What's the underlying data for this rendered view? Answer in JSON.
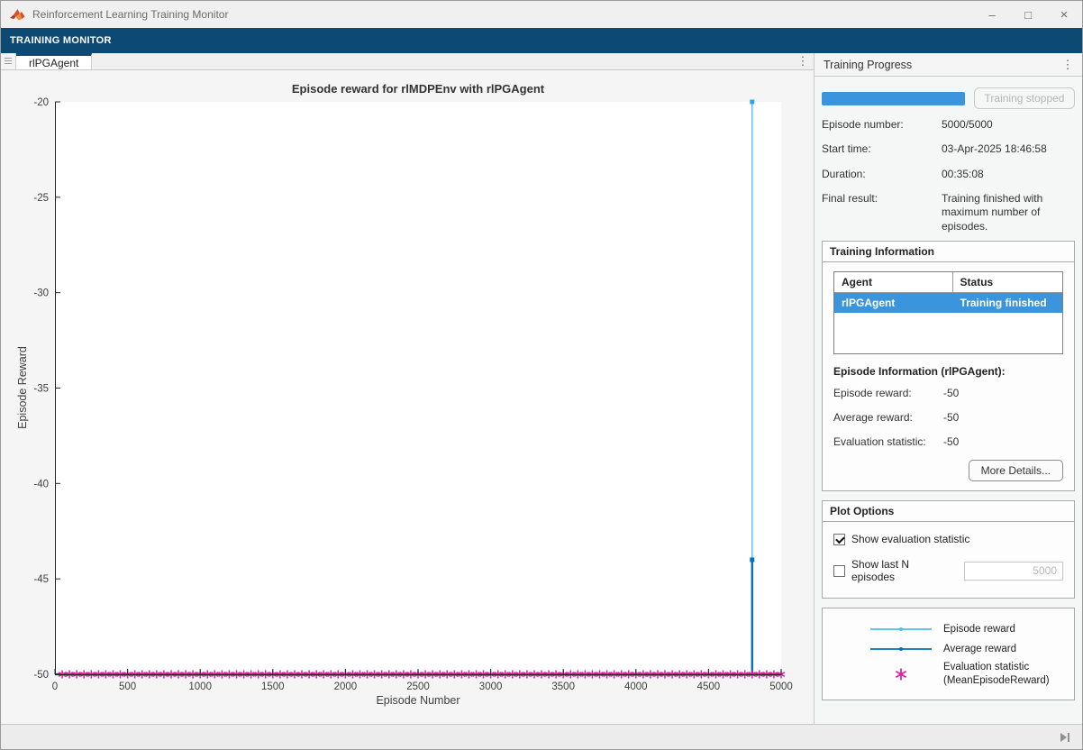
{
  "window": {
    "title": "Reinforcement Learning Training Monitor"
  },
  "toolstrip": {
    "tab_label": "TRAINING MONITOR"
  },
  "doc_tabs": {
    "active_label": "rlPGAgent"
  },
  "right_panel": {
    "header": "Training Progress",
    "progress": {
      "percent": 100,
      "button_label": "Training stopped"
    },
    "fields": [
      {
        "label": "Episode number:",
        "value": "5000/5000"
      },
      {
        "label": "Start time:",
        "value": "03-Apr-2025 18:46:58"
      },
      {
        "label": "Duration:",
        "value": "00:35:08"
      },
      {
        "label": "Final result:",
        "value": "Training finished with maximum number of episodes."
      }
    ],
    "training_information": {
      "title": "Training Information",
      "table": {
        "headers": [
          "Agent",
          "Status"
        ],
        "rows": [
          {
            "agent": "rlPGAgent",
            "status": "Training finished",
            "selected": true
          }
        ]
      },
      "episode_info_title": "Episode Information (rlPGAgent):",
      "stats": [
        {
          "label": "Episode reward:",
          "value": "-50"
        },
        {
          "label": "Average reward:",
          "value": "-50"
        },
        {
          "label": "Evaluation statistic:",
          "value": "-50"
        }
      ],
      "more_details_label": "More Details..."
    },
    "plot_options": {
      "title": "Plot Options",
      "show_eval": {
        "label": "Show evaluation statistic",
        "checked": true
      },
      "show_last_n": {
        "label": "Show last N episodes",
        "checked": false,
        "value": "5000"
      }
    },
    "legend": {
      "items": [
        {
          "label": "Episode reward",
          "marker": "line-dot",
          "color": "#4DBEEE"
        },
        {
          "label": "Average reward",
          "marker": "line-dot",
          "color": "#0072BD"
        },
        {
          "label": "Evaluation statistic",
          "label2": "(MeanEpisodeReward)",
          "marker": "asterisk",
          "color": "#DE1B9E"
        }
      ]
    }
  },
  "colors": {
    "banner_blue": "#0d4a73",
    "selection_blue": "#3a95dc",
    "episode_reward_cyan": "#4DBEEE",
    "average_reward_blue": "#0072BD",
    "evaluation_magenta": "#DE1B9E"
  },
  "chart_data": {
    "type": "line",
    "title": "Episode reward for rlMDPEnv with rlPGAgent",
    "xlabel": "Episode Number",
    "ylabel": "Episode Reward",
    "xlim": [
      0,
      5000
    ],
    "ylim": [
      -50,
      -20
    ],
    "xticks": [
      0,
      500,
      1000,
      1500,
      2000,
      2500,
      3000,
      3500,
      4000,
      4500,
      5000
    ],
    "yticks": [
      -20,
      -25,
      -30,
      -35,
      -40,
      -45,
      -50
    ],
    "grid": false,
    "legend_position": "external-right-panel",
    "series": [
      {
        "name": "Episode reward",
        "type": "line",
        "color": "#4DBEEE",
        "width": 1.4,
        "description": "All episode rewards equal -50 except one spike to -20 near episode 4800",
        "points": [
          [
            0,
            -50
          ],
          [
            4800,
            -50
          ],
          [
            4800,
            -20
          ],
          [
            4800,
            -50
          ],
          [
            5000,
            -50
          ]
        ],
        "marker": [
          4800,
          -20
        ],
        "marker_color": "#2EA8E0"
      },
      {
        "name": "Average reward",
        "type": "line",
        "color": "#0072BD",
        "width": 2.4,
        "description": "Average reward stays at -50 except a spike to about -44 near episode 4800",
        "points": [
          [
            0,
            -50
          ],
          [
            4800,
            -50
          ],
          [
            4800,
            -44
          ],
          [
            4800,
            -50
          ],
          [
            5000,
            -50
          ]
        ],
        "marker": [
          4800,
          -44
        ],
        "marker_color": "#0072BD"
      },
      {
        "name": "Evaluation statistic",
        "type": "asterisk",
        "color": "#DE1B9E",
        "description": "Evaluation statistic = -50 at every evaluation episode (every 50 episodes)",
        "x_start": 50,
        "x_step": 50,
        "x_end": 5000,
        "y": -50
      }
    ]
  }
}
